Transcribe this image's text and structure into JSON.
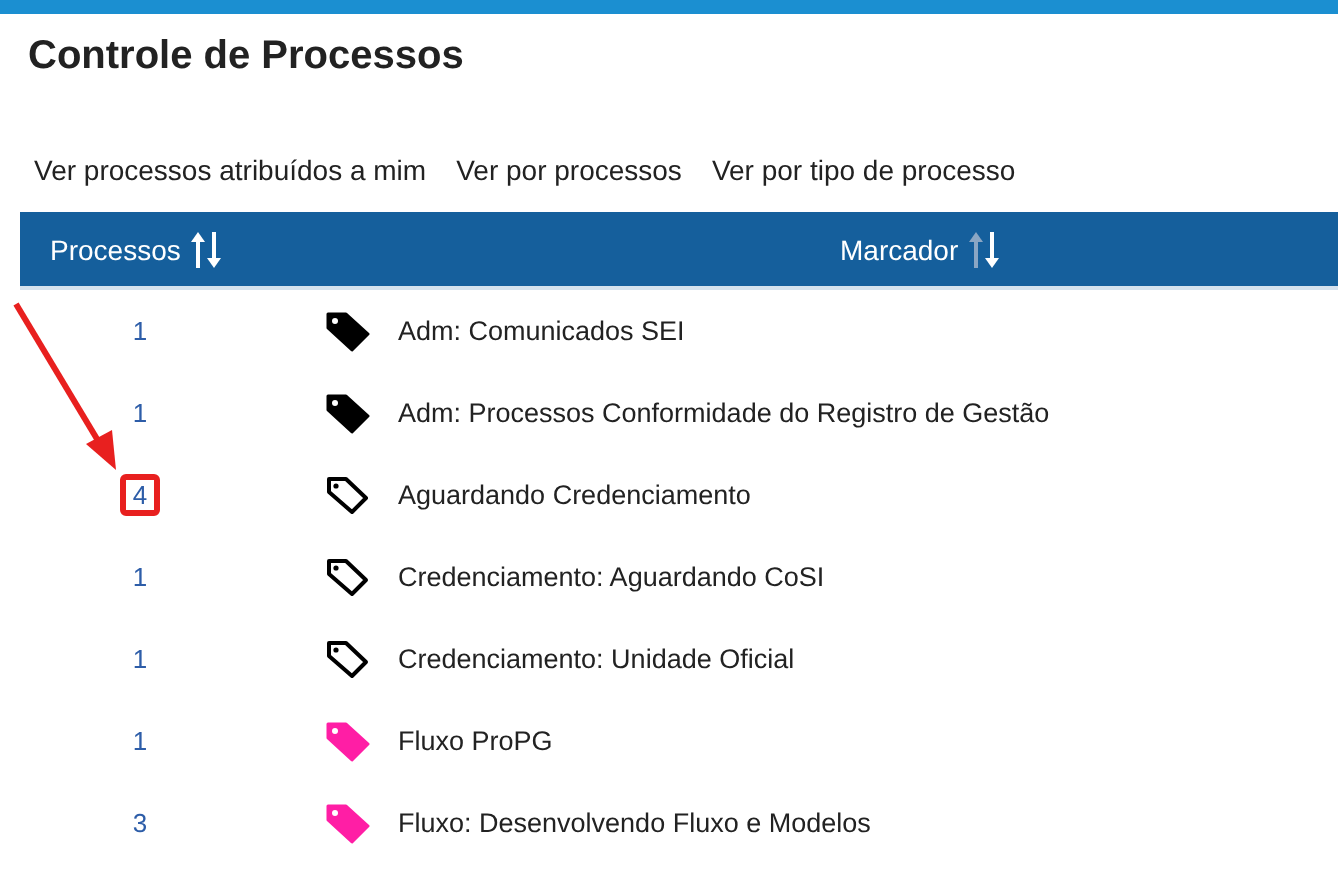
{
  "title": "Controle de Processos",
  "links": [
    "Ver processos atribuídos a mim",
    "Ver por processos",
    "Ver por tipo de processo"
  ],
  "table": {
    "columns": [
      {
        "label": "Processos",
        "up_active": true,
        "down_active": true
      },
      {
        "label": "Marcador",
        "up_active": false,
        "down_active": true
      }
    ],
    "rows": [
      {
        "count": "1",
        "kind": "filled",
        "color": "#000000",
        "label": "Adm: Comunicados SEI",
        "highlighted": false
      },
      {
        "count": "1",
        "kind": "filled",
        "color": "#000000",
        "label": "Adm: Processos Conformidade do Registro de Gestão",
        "highlighted": false
      },
      {
        "count": "4",
        "kind": "outline",
        "label": "Aguardando Credenciamento",
        "highlighted": true
      },
      {
        "count": "1",
        "kind": "outline",
        "label": "Credenciamento: Aguardando CoSI",
        "highlighted": false
      },
      {
        "count": "1",
        "kind": "outline",
        "label": "Credenciamento: Unidade Oficial",
        "highlighted": false
      },
      {
        "count": "1",
        "kind": "filled",
        "color": "#ff1ea5",
        "label": "Fluxo ProPG",
        "highlighted": false
      },
      {
        "count": "3",
        "kind": "filled",
        "color": "#ff1ea5",
        "label": "Fluxo: Desenvolvendo Fluxo e Modelos",
        "highlighted": false
      }
    ]
  }
}
